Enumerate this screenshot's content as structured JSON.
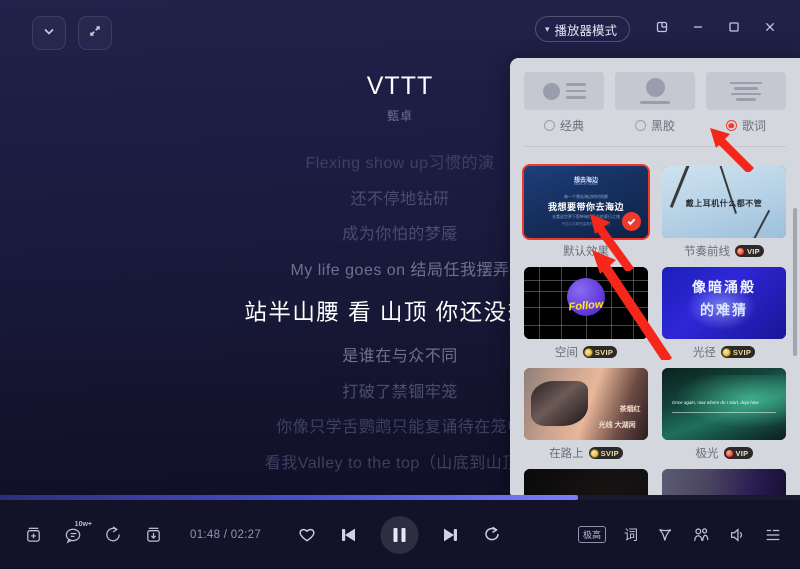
{
  "window": {
    "collapse_icon": "chevron-down-icon",
    "expand_icon": "expand-icon",
    "mode_label": "播放器模式",
    "mode_chevron": "▾",
    "mini_icon": "mini-window-icon",
    "minimize_icon": "minimize-icon",
    "maximize_icon": "maximize-icon",
    "close_icon": "close-icon"
  },
  "player": {
    "title": "VTTT",
    "artist": "甄卓",
    "lyrics": [
      {
        "text": "Flexing show up习惯的演",
        "state": "dim2"
      },
      {
        "text": "还不停地钻研",
        "state": "dim1"
      },
      {
        "text": "成为你怕的梦魇",
        "state": "dim1"
      },
      {
        "text": "My life goes on 结局任我摆弄",
        "state": "normal"
      },
      {
        "text": "站半山腰 看 山顶 你还没想到",
        "state": "active"
      },
      {
        "text": "是谁在与众不同",
        "state": "normal"
      },
      {
        "text": "打破了禁锢牢笼",
        "state": "dim1"
      },
      {
        "text": "你像只学舌鹦鹉只能复诵待在笼中",
        "state": "dim2"
      },
      {
        "text": "看我Valley to the top（山底到山顶）",
        "state": "dim2"
      }
    ],
    "progress_percent": 72,
    "time_elapsed": "01:48",
    "time_total": "02:27",
    "time_display": "01:48 / 02:27"
  },
  "bottom_left": [
    {
      "name": "add-to-playlist-icon",
      "label": "添加"
    },
    {
      "name": "comment-icon",
      "label": "评论",
      "count": "10w+"
    },
    {
      "name": "share-icon",
      "label": "分享"
    },
    {
      "name": "download-icon",
      "label": "下载"
    }
  ],
  "bottom_center": [
    {
      "name": "favorite-icon",
      "label": "喜欢"
    },
    {
      "name": "previous-track-button",
      "label": "上一首"
    },
    {
      "name": "pause-button",
      "label": "暂停"
    },
    {
      "name": "next-track-button",
      "label": "下一首"
    },
    {
      "name": "repeat-mode-button",
      "label": "循环"
    }
  ],
  "bottom_right": {
    "quality_badge": "极高",
    "items": [
      {
        "name": "lyrics-icon",
        "glyph": "词",
        "label": "歌词"
      },
      {
        "name": "sound-effect-icon",
        "label": "音效"
      },
      {
        "name": "listen-together-icon",
        "label": "一起听"
      },
      {
        "name": "volume-icon",
        "label": "音量"
      },
      {
        "name": "playlist-icon",
        "label": "播放列表"
      }
    ]
  },
  "panel": {
    "layouts": [
      {
        "label": "经典",
        "selected": false,
        "thumb": "classic-layout-thumb"
      },
      {
        "label": "黑胶",
        "selected": false,
        "thumb": "vinyl-layout-thumb"
      },
      {
        "label": "歌词",
        "selected": true,
        "thumb": "lyrics-layout-thumb"
      }
    ],
    "themes": [
      {
        "label": "默认效果",
        "badge": "",
        "selected": true,
        "art": "default",
        "art_text": {
          "t1": "想去海边",
          "t2": "BEACH SONG",
          "t3": "每一个想去海边的时刻都",
          "t4": "我想要带你去海边",
          "t5": "去看这世界下那种绚烂多彩的夏日之旅",
          "t6": "不过心中那些温柔的向往都还在"
        }
      },
      {
        "label": "节奏前线",
        "badge": "VIP",
        "badge_type": "vip",
        "selected": false,
        "art": "sky",
        "art_text": {
          "caption": "戴上耳机什么都不管"
        }
      },
      {
        "label": "空间",
        "badge": "SVIP",
        "badge_type": "svip",
        "selected": false,
        "art": "space",
        "art_text": {
          "caption": "Follow"
        }
      },
      {
        "label": "光径",
        "badge": "SVIP",
        "badge_type": "svip",
        "selected": false,
        "art": "blue",
        "art_text": {
          "l1": "像暗涌般",
          "l2": "的难猜"
        }
      },
      {
        "label": "在路上",
        "badge": "SVIP",
        "badge_type": "svip",
        "selected": false,
        "art": "road",
        "art_text": {
          "r1": "茶烟红",
          "r2": "光线 大湖闲"
        }
      },
      {
        "label": "极光",
        "badge": "VIP",
        "badge_type": "vip",
        "selected": false,
        "art": "aurora",
        "art_text": {
          "caption": "Once again, now where do I start, deja how"
        }
      },
      {
        "label": "",
        "badge": "",
        "selected": false,
        "art": "dark",
        "art_text": {}
      },
      {
        "label": "",
        "badge": "",
        "selected": false,
        "art": "purple",
        "art_text": {}
      }
    ],
    "selected_check_icon": "check-icon"
  },
  "colors": {
    "accent_red": "#f0392b",
    "progress": "#7b7bff",
    "background_top": "#21214a",
    "background_bottom": "#0c0c20",
    "panel_bg": "#d5d7de"
  }
}
